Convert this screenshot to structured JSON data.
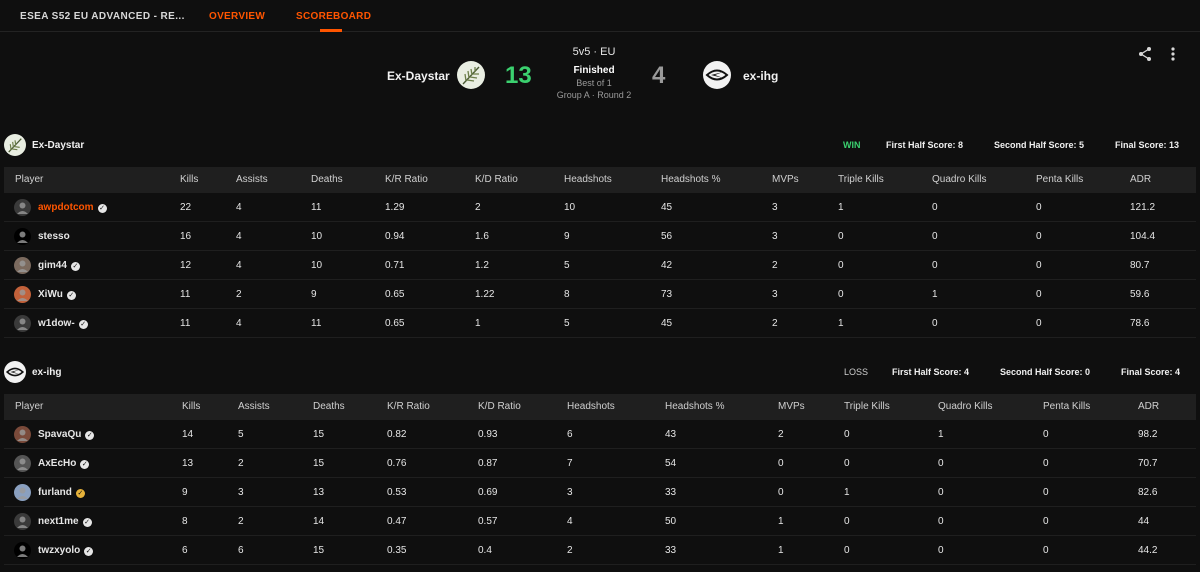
{
  "nav": {
    "title": "ESEA S52 EU ADVANCED - RE...",
    "tabs": [
      {
        "label": "OVERVIEW"
      },
      {
        "label": "SCOREBOARD"
      }
    ]
  },
  "match": {
    "team1": {
      "name": "Ex-Daystar",
      "score": "13"
    },
    "team2": {
      "name": "ex-ihg",
      "score": "4"
    },
    "mode": "5v5 · EU",
    "status": "Finished",
    "best_of": "Best of 1",
    "group": "Group A · Round 2",
    "icons": [
      "share-icon",
      "more-vertical-icon"
    ],
    "colors": {
      "winner_score": "#3bd16f",
      "loser_score": "#9a9a9a",
      "accent": "#ff5500"
    }
  },
  "headers": [
    "Player",
    "Kills",
    "Assists",
    "Deaths",
    "K/R Ratio",
    "K/D Ratio",
    "Headshots",
    "Headshots %",
    "MVPs",
    "Triple Kills",
    "Quadro Kills",
    "Penta Kills",
    "ADR"
  ],
  "teams": [
    {
      "name": "Ex-Daystar",
      "result": "WIN",
      "first_half": "First Half Score: 8",
      "second_half": "Second Half Score: 5",
      "final": "Final Score: 13",
      "players": [
        {
          "name": "awpdotcom",
          "verified": true,
          "stats": [
            "22",
            "4",
            "11",
            "1.29",
            "2",
            "10",
            "45",
            "3",
            "1",
            "0",
            "0",
            "121.2"
          ]
        },
        {
          "name": "stesso",
          "verified": false,
          "stats": [
            "16",
            "4",
            "10",
            "0.94",
            "1.6",
            "9",
            "56",
            "3",
            "0",
            "0",
            "0",
            "104.4"
          ]
        },
        {
          "name": "gim44",
          "verified": true,
          "stats": [
            "12",
            "4",
            "10",
            "0.71",
            "1.2",
            "5",
            "42",
            "2",
            "0",
            "0",
            "0",
            "80.7"
          ]
        },
        {
          "name": "XiWu",
          "verified": true,
          "stats": [
            "11",
            "2",
            "9",
            "0.65",
            "1.22",
            "8",
            "73",
            "3",
            "0",
            "1",
            "0",
            "59.6"
          ]
        },
        {
          "name": "w1dow-",
          "verified": true,
          "stats": [
            "11",
            "4",
            "11",
            "0.65",
            "1",
            "5",
            "45",
            "2",
            "1",
            "0",
            "0",
            "78.6"
          ]
        }
      ]
    },
    {
      "name": "ex-ihg",
      "result": "LOSS",
      "first_half": "First Half Score: 4",
      "second_half": "Second Half Score: 0",
      "final": "Final Score: 4",
      "players": [
        {
          "name": "SpavaQu",
          "verified": true,
          "stats": [
            "14",
            "5",
            "15",
            "0.82",
            "0.93",
            "6",
            "43",
            "2",
            "0",
            "1",
            "0",
            "98.2"
          ]
        },
        {
          "name": "AxEcHo",
          "verified": true,
          "stats": [
            "13",
            "2",
            "15",
            "0.76",
            "0.87",
            "7",
            "54",
            "0",
            "0",
            "0",
            "0",
            "70.7"
          ]
        },
        {
          "name": "furland",
          "verified": true,
          "stats": [
            "9",
            "3",
            "13",
            "0.53",
            "0.69",
            "3",
            "33",
            "0",
            "1",
            "0",
            "0",
            "82.6"
          ]
        },
        {
          "name": "next1me",
          "verified": true,
          "stats": [
            "8",
            "2",
            "14",
            "0.47",
            "0.57",
            "4",
            "50",
            "1",
            "0",
            "0",
            "0",
            "44"
          ]
        },
        {
          "name": "twzxyolo",
          "verified": true,
          "stats": [
            "6",
            "6",
            "15",
            "0.35",
            "0.4",
            "2",
            "33",
            "1",
            "0",
            "0",
            "0",
            "44.2"
          ]
        }
      ]
    }
  ]
}
